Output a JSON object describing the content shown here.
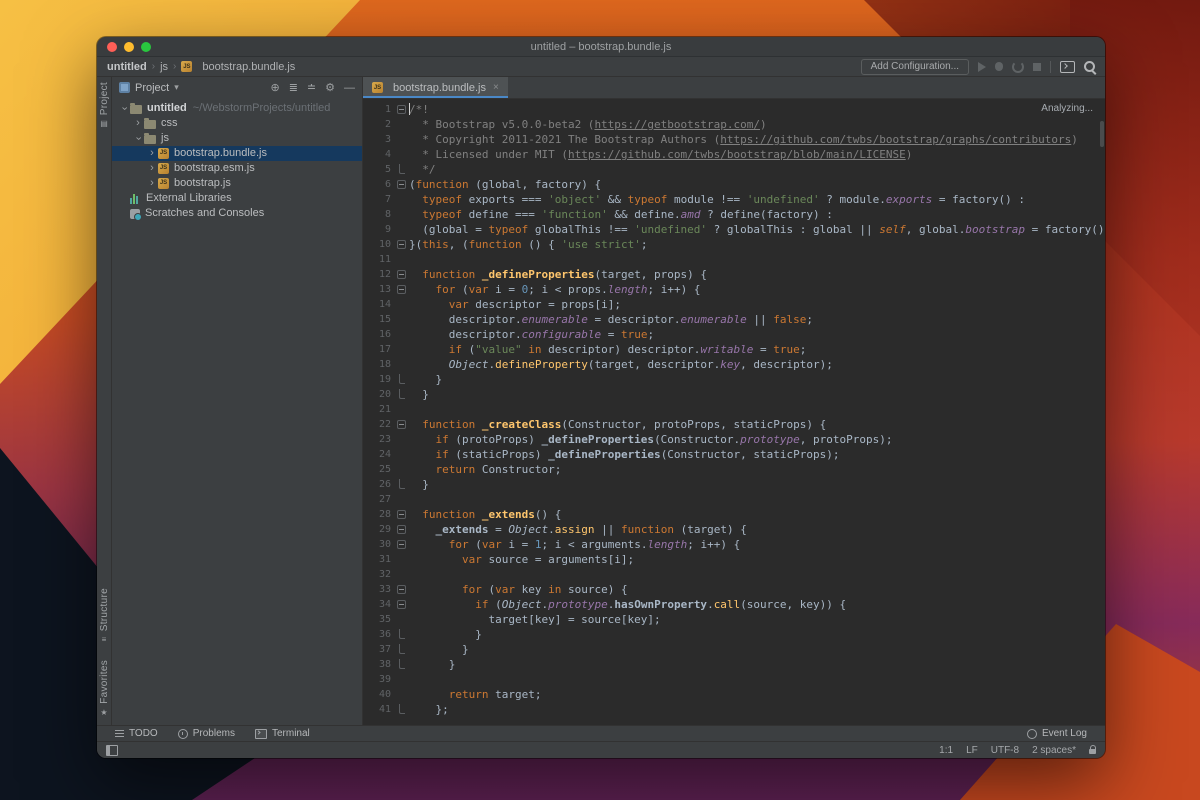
{
  "colors": {
    "panel_bg": "#3C3F41",
    "editor_bg": "#2B2B2B",
    "tab_underline": "#4A88C7",
    "tree_selection": "#15395E",
    "keyword_orange": "#CC7832",
    "string_green": "#6A8759",
    "property_purple": "#9876AA"
  },
  "icons": {
    "js_badge": "JS",
    "chevron": "›",
    "dropdown_caret": "▾",
    "breadcrumb_sep": "›",
    "locate": "⊕",
    "expand_all": "≣",
    "collapse_all": "≐",
    "settings": "⚙",
    "hide": "—",
    "close_tab": "×",
    "star": "★",
    "stripe_project": "▤",
    "stripe_structure": "≡"
  },
  "window": {
    "title": "untitled – bootstrap.bundle.js"
  },
  "breadcrumbs": {
    "items": [
      "untitled",
      "js",
      "bootstrap.bundle.js"
    ]
  },
  "run_toolbar": {
    "add_configuration": "Add Configuration..."
  },
  "tool_stripe": {
    "project": "Project",
    "structure": "Structure",
    "favorites": "Favorites"
  },
  "project_panel": {
    "title": "Project",
    "tree": [
      {
        "label": "untitled",
        "hint": "~/WebstormProjects/untitled",
        "icon": "folder",
        "indent": 0,
        "chevron": "down",
        "bold": true,
        "selected": false
      },
      {
        "label": "css",
        "hint": "",
        "icon": "folder",
        "indent": 1,
        "chevron": "right",
        "bold": false,
        "selected": false
      },
      {
        "label": "js",
        "hint": "",
        "icon": "folder",
        "indent": 1,
        "chevron": "down",
        "bold": false,
        "selected": false
      },
      {
        "label": "bootstrap.bundle.js",
        "hint": "",
        "icon": "js",
        "indent": 2,
        "chevron": "right",
        "bold": false,
        "selected": true
      },
      {
        "label": "bootstrap.esm.js",
        "hint": "",
        "icon": "js",
        "indent": 2,
        "chevron": "right",
        "bold": false,
        "selected": false
      },
      {
        "label": "bootstrap.js",
        "hint": "",
        "icon": "js",
        "indent": 2,
        "chevron": "right",
        "bold": false,
        "selected": false
      },
      {
        "label": "External Libraries",
        "hint": "",
        "icon": "lib",
        "indent": 0,
        "chevron": "",
        "bold": false,
        "selected": false
      },
      {
        "label": "Scratches and Consoles",
        "hint": "",
        "icon": "scratch",
        "indent": 0,
        "chevron": "",
        "bold": false,
        "selected": false
      }
    ]
  },
  "editor": {
    "tab_label": "bootstrap.bundle.js",
    "analyzing_label": "Analyzing...",
    "lines": [
      {
        "fold": "m",
        "seg": [
          [
            "c",
            "/*!"
          ]
        ]
      },
      {
        "fold": "",
        "seg": [
          [
            "c",
            "  * Bootstrap v5.0.0-beta2 ("
          ],
          [
            "u",
            "https://getbootstrap.com/"
          ],
          [
            "c",
            ")"
          ]
        ]
      },
      {
        "fold": "",
        "seg": [
          [
            "c",
            "  * Copyright 2011-2021 The Bootstrap Authors ("
          ],
          [
            "u",
            "https://github.com/twbs/bootstrap/graphs/contributors"
          ],
          [
            "c",
            ")"
          ]
        ]
      },
      {
        "fold": "",
        "seg": [
          [
            "c",
            "  * Licensed under MIT ("
          ],
          [
            "u",
            "https://github.com/twbs/bootstrap/blob/main/LICENSE"
          ],
          [
            "c",
            ")"
          ]
        ]
      },
      {
        "fold": "e",
        "seg": [
          [
            "c",
            "  */"
          ]
        ]
      },
      {
        "fold": "m",
        "seg": [
          [
            "d",
            "("
          ],
          [
            "k",
            "function"
          ],
          [
            "d",
            " (global, factory) {"
          ]
        ]
      },
      {
        "fold": "",
        "seg": [
          [
            "d",
            "  "
          ],
          [
            "k",
            "typeof"
          ],
          [
            "d",
            " exports === "
          ],
          [
            "s",
            "'object'"
          ],
          [
            "d",
            " && "
          ],
          [
            "k",
            "typeof"
          ],
          [
            "d",
            " module !== "
          ],
          [
            "s",
            "'undefined'"
          ],
          [
            "d",
            " ? module."
          ],
          [
            "p",
            "exports"
          ],
          [
            "d",
            " = factory() :"
          ]
        ]
      },
      {
        "fold": "",
        "seg": [
          [
            "d",
            "  "
          ],
          [
            "k",
            "typeof"
          ],
          [
            "d",
            " define === "
          ],
          [
            "s",
            "'function'"
          ],
          [
            "d",
            " && define."
          ],
          [
            "p",
            "amd"
          ],
          [
            "d",
            " ? define(factory) :"
          ]
        ]
      },
      {
        "fold": "",
        "seg": [
          [
            "d",
            "  (global = "
          ],
          [
            "k",
            "typeof"
          ],
          [
            "d",
            " globalThis !== "
          ],
          [
            "s",
            "'undefined'"
          ],
          [
            "d",
            " ? globalThis : global || "
          ],
          [
            "se",
            "self"
          ],
          [
            "d",
            ", global."
          ],
          [
            "p",
            "bootstrap"
          ],
          [
            "d",
            " = factory());"
          ]
        ]
      },
      {
        "fold": "m",
        "seg": [
          [
            "d",
            "}("
          ],
          [
            "k",
            "this"
          ],
          [
            "d",
            ", ("
          ],
          [
            "k",
            "function"
          ],
          [
            "d",
            " () { "
          ],
          [
            "s",
            "'use strict'"
          ],
          [
            "d",
            ";"
          ]
        ]
      },
      {
        "fold": "",
        "seg": []
      },
      {
        "fold": "m",
        "seg": [
          [
            "d",
            "  "
          ],
          [
            "k",
            "function"
          ],
          [
            "d",
            " "
          ],
          [
            "f",
            "_defineProperties"
          ],
          [
            "d",
            "(target, props) {"
          ]
        ]
      },
      {
        "fold": "m",
        "seg": [
          [
            "d",
            "    "
          ],
          [
            "k",
            "for"
          ],
          [
            "d",
            " ("
          ],
          [
            "k",
            "var"
          ],
          [
            "d",
            " i = "
          ],
          [
            "n",
            "0"
          ],
          [
            "d",
            "; i < props."
          ],
          [
            "p",
            "length"
          ],
          [
            "d",
            "; i++) {"
          ]
        ]
      },
      {
        "fold": "",
        "seg": [
          [
            "d",
            "      "
          ],
          [
            "k",
            "var"
          ],
          [
            "d",
            " descriptor = props[i];"
          ]
        ]
      },
      {
        "fold": "",
        "seg": [
          [
            "d",
            "      descriptor."
          ],
          [
            "p",
            "enumerable"
          ],
          [
            "d",
            " = descriptor."
          ],
          [
            "p",
            "enumerable"
          ],
          [
            "d",
            " || "
          ],
          [
            "k",
            "false"
          ],
          [
            "d",
            ";"
          ]
        ]
      },
      {
        "fold": "",
        "seg": [
          [
            "d",
            "      descriptor."
          ],
          [
            "p",
            "configurable"
          ],
          [
            "d",
            " = "
          ],
          [
            "k",
            "true"
          ],
          [
            "d",
            ";"
          ]
        ]
      },
      {
        "fold": "",
        "seg": [
          [
            "d",
            "      "
          ],
          [
            "k",
            "if"
          ],
          [
            "d",
            " ("
          ],
          [
            "s",
            "\"value\""
          ],
          [
            "d",
            " "
          ],
          [
            "k",
            "in"
          ],
          [
            "d",
            " descriptor) descriptor."
          ],
          [
            "p",
            "writable"
          ],
          [
            "d",
            " = "
          ],
          [
            "k",
            "true"
          ],
          [
            "d",
            ";"
          ]
        ]
      },
      {
        "fold": "",
        "seg": [
          [
            "d",
            "      "
          ],
          [
            "it",
            "Object"
          ],
          [
            "d",
            "."
          ],
          [
            "m",
            "defineProperty"
          ],
          [
            "d",
            "(target, descriptor."
          ],
          [
            "p",
            "key"
          ],
          [
            "d",
            ", descriptor);"
          ]
        ]
      },
      {
        "fold": "e",
        "seg": [
          [
            "d",
            "    }"
          ]
        ]
      },
      {
        "fold": "e",
        "seg": [
          [
            "d",
            "  }"
          ]
        ]
      },
      {
        "fold": "",
        "seg": []
      },
      {
        "fold": "m",
        "seg": [
          [
            "d",
            "  "
          ],
          [
            "k",
            "function"
          ],
          [
            "d",
            " "
          ],
          [
            "f",
            "_createClass"
          ],
          [
            "d",
            "(Constructor, protoProps, staticProps) {"
          ]
        ]
      },
      {
        "fold": "",
        "seg": [
          [
            "d",
            "    "
          ],
          [
            "k",
            "if"
          ],
          [
            "d",
            " (protoProps) "
          ],
          [
            "b",
            "_defineProperties"
          ],
          [
            "d",
            "(Constructor."
          ],
          [
            "p",
            "prototype"
          ],
          [
            "d",
            ", protoProps);"
          ]
        ]
      },
      {
        "fold": "",
        "seg": [
          [
            "d",
            "    "
          ],
          [
            "k",
            "if"
          ],
          [
            "d",
            " (staticProps) "
          ],
          [
            "b",
            "_defineProperties"
          ],
          [
            "d",
            "(Constructor, staticProps);"
          ]
        ]
      },
      {
        "fold": "",
        "seg": [
          [
            "d",
            "    "
          ],
          [
            "k",
            "return"
          ],
          [
            "d",
            " Constructor;"
          ]
        ]
      },
      {
        "fold": "e",
        "seg": [
          [
            "d",
            "  }"
          ]
        ]
      },
      {
        "fold": "",
        "seg": []
      },
      {
        "fold": "m",
        "seg": [
          [
            "d",
            "  "
          ],
          [
            "k",
            "function"
          ],
          [
            "d",
            " "
          ],
          [
            "f",
            "_extends"
          ],
          [
            "d",
            "() {"
          ]
        ]
      },
      {
        "fold": "m",
        "seg": [
          [
            "d",
            "    "
          ],
          [
            "b",
            "_extends"
          ],
          [
            "d",
            " = "
          ],
          [
            "it",
            "Object"
          ],
          [
            "d",
            "."
          ],
          [
            "m",
            "assign"
          ],
          [
            "d",
            " || "
          ],
          [
            "k",
            "function"
          ],
          [
            "d",
            " (target) {"
          ]
        ]
      },
      {
        "fold": "m",
        "seg": [
          [
            "d",
            "      "
          ],
          [
            "k",
            "for"
          ],
          [
            "d",
            " ("
          ],
          [
            "k",
            "var"
          ],
          [
            "d",
            " i = "
          ],
          [
            "n",
            "1"
          ],
          [
            "d",
            "; i < arguments."
          ],
          [
            "p",
            "length"
          ],
          [
            "d",
            "; i++) {"
          ]
        ]
      },
      {
        "fold": "",
        "seg": [
          [
            "d",
            "        "
          ],
          [
            "k",
            "var"
          ],
          [
            "d",
            " source = arguments[i];"
          ]
        ]
      },
      {
        "fold": "",
        "seg": []
      },
      {
        "fold": "m",
        "seg": [
          [
            "d",
            "        "
          ],
          [
            "k",
            "for"
          ],
          [
            "d",
            " ("
          ],
          [
            "k",
            "var"
          ],
          [
            "d",
            " key "
          ],
          [
            "k",
            "in"
          ],
          [
            "d",
            " source) {"
          ]
        ]
      },
      {
        "fold": "m",
        "seg": [
          [
            "d",
            "          "
          ],
          [
            "k",
            "if"
          ],
          [
            "d",
            " ("
          ],
          [
            "it",
            "Object"
          ],
          [
            "d",
            "."
          ],
          [
            "p",
            "prototype"
          ],
          [
            "d",
            "."
          ],
          [
            "b",
            "hasOwnProperty"
          ],
          [
            "d",
            "."
          ],
          [
            "m",
            "call"
          ],
          [
            "d",
            "(source, key)) {"
          ]
        ]
      },
      {
        "fold": "",
        "seg": [
          [
            "d",
            "            target[key] = source[key];"
          ]
        ]
      },
      {
        "fold": "e",
        "seg": [
          [
            "d",
            "          }"
          ]
        ]
      },
      {
        "fold": "e",
        "seg": [
          [
            "d",
            "        }"
          ]
        ]
      },
      {
        "fold": "e",
        "seg": [
          [
            "d",
            "      }"
          ]
        ]
      },
      {
        "fold": "",
        "seg": []
      },
      {
        "fold": "",
        "seg": [
          [
            "d",
            "      "
          ],
          [
            "k",
            "return"
          ],
          [
            "d",
            " target;"
          ]
        ]
      },
      {
        "fold": "e",
        "seg": [
          [
            "d",
            "    };"
          ]
        ]
      }
    ]
  },
  "bottom_bar": {
    "todo": "TODO",
    "problems": "Problems",
    "terminal": "Terminal",
    "event_log": "Event Log"
  },
  "status_bar": {
    "caret_position": "1:1",
    "line_separator": "LF",
    "encoding": "UTF-8",
    "indent": "2 spaces*"
  }
}
